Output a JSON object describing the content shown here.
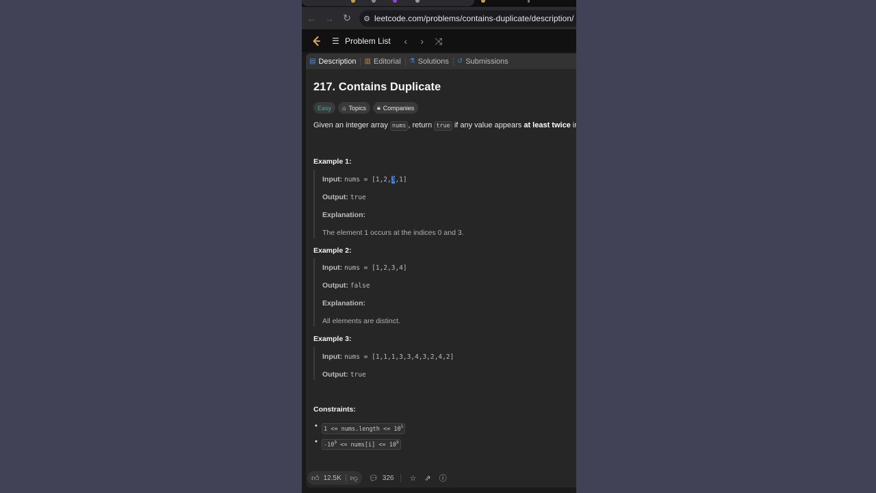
{
  "colors": {
    "outer_bg": "#424257",
    "accent": "#3f8ff6",
    "easy": "#3ea9a6"
  },
  "browser": {
    "url": "leetcode.com/problems/contains-duplicate/description/",
    "icons": [
      "back-arrow-icon",
      "forward-arrow-icon",
      "reload-icon",
      "site-info-icon"
    ]
  },
  "header": {
    "problem_list_label": "Problem List"
  },
  "tabs": [
    {
      "label": "Description",
      "icon": "document-icon"
    },
    {
      "label": "Editorial",
      "icon": "book-icon"
    },
    {
      "label": "Solutions",
      "icon": "flask-icon"
    },
    {
      "label": "Submissions",
      "icon": "history-icon"
    }
  ],
  "problem": {
    "title": "217. Contains Duplicate",
    "difficulty": "Easy",
    "topics_label": "Topics",
    "companies_label": "Companies",
    "desc_pre": "Given an integer array ",
    "desc_code1": "nums",
    "desc_mid": ", return ",
    "desc_code2": "true",
    "desc_post": " if any value appears ",
    "desc_bold": "at least twice",
    "desc_end": " in the array"
  },
  "examples": [
    {
      "heading": "Example 1:",
      "input_label": "Input:",
      "input_pre": "nums = [1,2,",
      "input_sel": "3",
      "input_post": ",1]",
      "output_label": "Output:",
      "output": "true",
      "explanation_label": "Explanation:",
      "explanation": "The element 1 occurs at the indices 0 and 3."
    },
    {
      "heading": "Example 2:",
      "input_label": "Input:",
      "input": "nums = [1,2,3,4]",
      "output_label": "Output:",
      "output": "false",
      "explanation_label": "Explanation:",
      "explanation": "All elements are distinct."
    },
    {
      "heading": "Example 3:",
      "input_label": "Input:",
      "input": "nums = [1,1,1,3,3,4,3,2,4,2]",
      "output_label": "Output:",
      "output": "true"
    }
  ],
  "constraints": {
    "heading": "Constraints:",
    "c1_pre": "1 <= nums.length <= 10",
    "c1_sup": "5",
    "c2_pre": "-10",
    "c2_sup1": "9",
    "c2_mid": " <= nums[i] <= 10",
    "c2_sup2": "9"
  },
  "footer": {
    "likes": "12.5K",
    "comments": "326"
  }
}
